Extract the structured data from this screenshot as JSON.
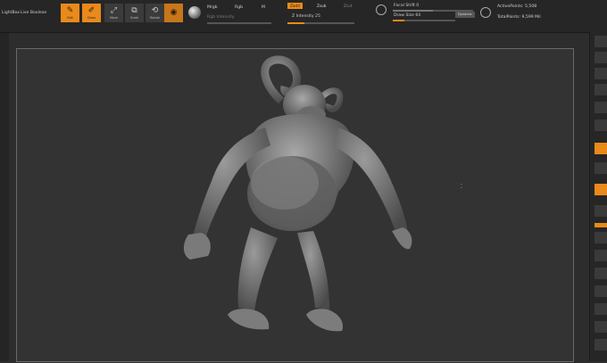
{
  "toolbar": {
    "lightbox_label": "LightBox",
    "live_boolean_label": "Live Boolean",
    "edit_label": "Edit",
    "draw_label": "Draw",
    "move_label": "Move",
    "scale_label": "Scale",
    "rotate_label": "Rotate",
    "mrgb_label": "Mrgb",
    "rgb_label": "Rgb",
    "m_label": "M",
    "zadd_label": "Zadd",
    "zsub_label": "Zsub",
    "zcut_label": "Zcut",
    "rgb_intensity_label": "Rgb Intensity",
    "z_intensity_label": "Z Intensity 25",
    "focal_shift_label": "Focal Shift 0",
    "draw_size_label": "Draw Size 64",
    "dynamic_label": "Dynamic",
    "active_points_label": "ActivePoints: 5,508",
    "total_points_label": "TotalPoints: 9,599 Mil"
  },
  "values": {
    "z_intensity": 25,
    "focal_shift": 0,
    "draw_size": 64
  },
  "colors": {
    "accent": "#e98a1a",
    "background": "#2d2d2d",
    "viewport": "#333333",
    "toolbar": "#262626"
  },
  "icons": {
    "edit": "edit-icon",
    "draw": "draw-icon",
    "move": "move-icon",
    "scale": "scale-icon",
    "rotate": "rotate-icon",
    "material": "material-sphere-icon",
    "focal": "focal-shift-icon",
    "drawsize": "draw-size-icon"
  }
}
